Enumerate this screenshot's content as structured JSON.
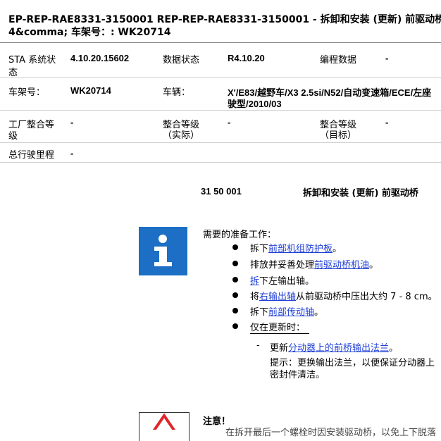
{
  "header": {
    "line1": "EP-REP-RAE8331-3150001   REP-REP-RAE8331-3150001 - 拆卸和安装 (更新) 前驱动桥  -",
    "line2": "4&comma; 车架号：: WK20714"
  },
  "info_table": {
    "ista_label_a": "STA 系统状",
    "ista_label_b": "态",
    "ista_value": "4.10.20.15602",
    "data_status_label": "数据状态",
    "data_status_value": "R4.10.20",
    "programming_label": "编程数据",
    "programming_value": "-",
    "vin_label": "车架号：",
    "vin_value": "WK20714",
    "vehicle_label": "车辆：",
    "vehicle_value_a": "X'/E83/越野车/X3 2.5si/N52/自动变速箱/ECE/左座",
    "vehicle_value_b": "驶型/2010/03",
    "factory_label_a": "工厂整合等",
    "factory_label_b": "级",
    "factory_value": "-",
    "integ_actual_label_a": "整合等级",
    "integ_actual_label_b": "（实际）",
    "integ_actual_value": "-",
    "integ_target_label_a": "整合等级",
    "integ_target_label_b": "（目标）",
    "integ_target_value": "-",
    "mileage_label": "总行驶里程",
    "mileage_value": "-"
  },
  "procedure": {
    "number": "31 50 001",
    "title": "拆卸和安装 (更新) 前驱动桥"
  },
  "prep": {
    "heading": "需要的准备工作：",
    "items": [
      {
        "pre": "拆下",
        "link": "前部机组防护板",
        "post": "。"
      },
      {
        "pre": "排放并妥善处理",
        "link": "前驱动桥机油",
        "post": "。"
      },
      {
        "pre": "",
        "link": "拆",
        "post": "下左输出轴。"
      },
      {
        "pre": "将",
        "link": "右输出轴",
        "post": "从前驱动桥中压出大约  7 - 8 cm。"
      },
      {
        "pre": "拆下",
        "link": "前部传动轴",
        "post": "。"
      },
      {
        "pre": "",
        "link": "仅在更新时：",
        "post": ""
      }
    ],
    "sub_dash": "-",
    "sub_pre": "更新",
    "sub_link": "分动器上的前桥输出法兰",
    "sub_post": "。",
    "hint_a": "提示：更换输出法兰，以便保证分动器上",
    "hint_b": "密封件清洁。"
  },
  "note": {
    "heading": "注意！",
    "text": "在拆开最后一个螺栓时因安装驱动桥，以免上下脱落"
  },
  "colors": {
    "link": "#1f3fd6",
    "info_blue": "#1c6fc4",
    "warn_red": "#e0262a"
  }
}
